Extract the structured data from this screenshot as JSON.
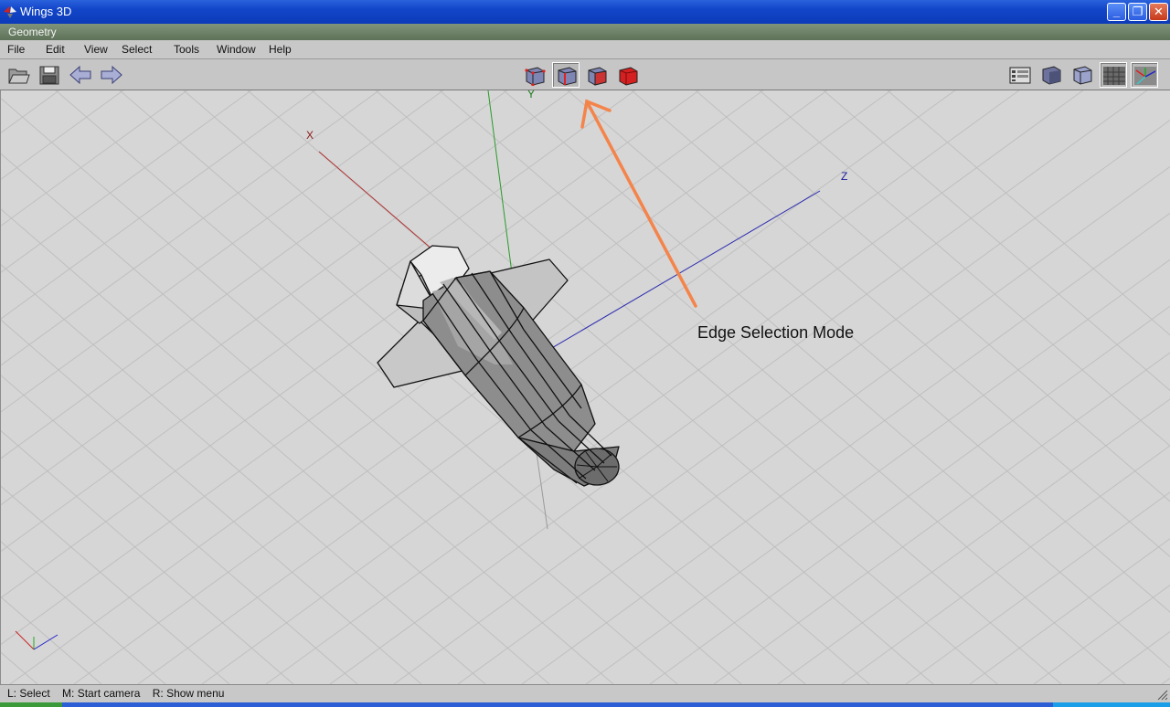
{
  "window": {
    "title": "Wings 3D",
    "app_icon": "wings-icon",
    "controls": {
      "minimize": "minimize-icon",
      "restore": "restore-icon",
      "close": "close-icon"
    }
  },
  "geometry_window": {
    "title": "Geometry"
  },
  "menubar": {
    "items": [
      {
        "label": "File"
      },
      {
        "label": "Edit"
      },
      {
        "label": "View"
      },
      {
        "label": "Select"
      },
      {
        "label": "Tools"
      },
      {
        "label": "Window"
      },
      {
        "label": "Help"
      }
    ]
  },
  "toolbar": {
    "file_buttons": [
      "open-icon",
      "save-icon",
      "undo-arrow-icon",
      "redo-arrow-icon"
    ],
    "selection_modes": [
      {
        "icon": "vertex-mode-icon",
        "selected": false
      },
      {
        "icon": "edge-mode-icon",
        "selected": true
      },
      {
        "icon": "face-mode-icon",
        "selected": false
      },
      {
        "icon": "body-mode-icon",
        "selected": false
      }
    ],
    "view_buttons": [
      "outliner-icon",
      "smooth-shading-icon",
      "wireframe-cube-icon",
      "groundplane-icon",
      "axes-icon"
    ]
  },
  "viewport": {
    "axes": {
      "x": "X",
      "y": "Y",
      "z": "Z"
    },
    "annotation": "Edge Selection Mode",
    "colors": {
      "annotation_arrow": "#f4844a",
      "x_axis": "#b03030",
      "y_axis": "#2a9a2a",
      "z_axis": "#2a2ab0"
    }
  },
  "statusbar": {
    "left": "L: Select",
    "middle": "M: Start camera",
    "right": "R: Show menu"
  }
}
